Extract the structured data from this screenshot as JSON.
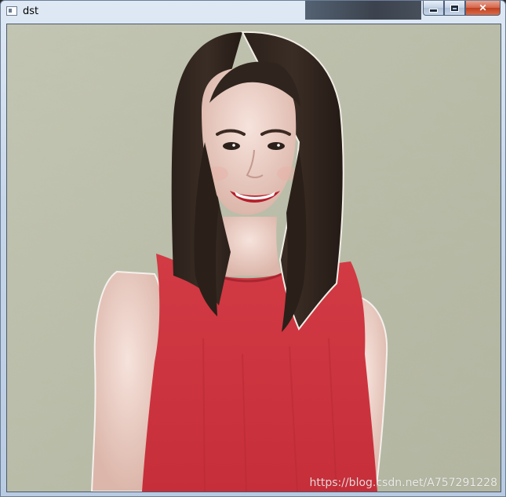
{
  "window": {
    "title": "dst",
    "buttons": {
      "minimize": "minimize",
      "maximize": "maximize",
      "close": "✕"
    }
  },
  "image": {
    "watermark": "https://blog.csdn.net/A757291228"
  },
  "colors": {
    "background": "#babea9",
    "dress": "#cf3a42",
    "hair": "#2f241e",
    "skin": "#e9cfc5"
  }
}
